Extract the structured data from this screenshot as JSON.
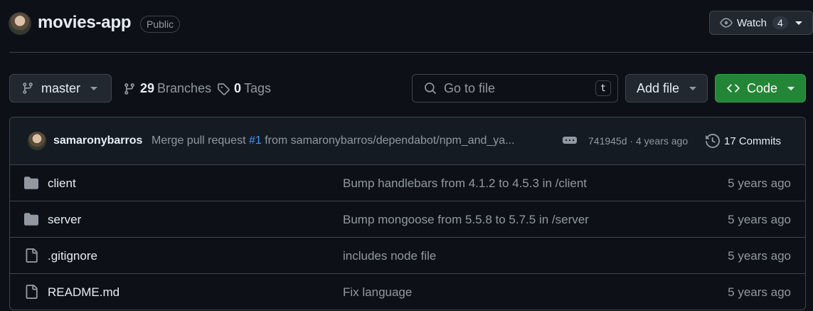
{
  "repo": {
    "name": "movies-app",
    "visibility": "Public"
  },
  "watch": {
    "label": "Watch",
    "count": "4"
  },
  "toolbar": {
    "branch": "master",
    "branches_count": "29",
    "branches_label": "Branches",
    "tags_count": "0",
    "tags_label": "Tags",
    "search_placeholder": "Go to file",
    "search_shortcut": "t",
    "add_file_label": "Add file",
    "code_label": "Code"
  },
  "latest_commit": {
    "author": "samaronybarros",
    "message_prefix": "Merge pull request",
    "pr_ref": "#1",
    "message_suffix": "from samaronybarros/dependabot/npm_and_ya...",
    "sha_time": "741945d · 4 years ago",
    "commits_label": "17 Commits"
  },
  "files": [
    {
      "type": "folder",
      "icon": "folder-icon",
      "name": "client",
      "message": "Bump handlebars from 4.1.2 to 4.5.3 in /client",
      "age": "5 years ago"
    },
    {
      "type": "folder",
      "icon": "folder-icon",
      "name": "server",
      "message": "Bump mongoose from 5.5.8 to 5.7.5 in /server",
      "age": "5 years ago"
    },
    {
      "type": "file",
      "icon": "file-icon",
      "name": ".gitignore",
      "message": "includes node file",
      "age": "5 years ago"
    },
    {
      "type": "file",
      "icon": "file-icon",
      "name": "README.md",
      "message": "Fix language",
      "age": "5 years ago"
    }
  ],
  "colors": {
    "background": "#0d1117",
    "accent_green": "#238636",
    "link_blue": "#4493f8",
    "muted_text": "#9198a1",
    "border": "#3d444d"
  }
}
